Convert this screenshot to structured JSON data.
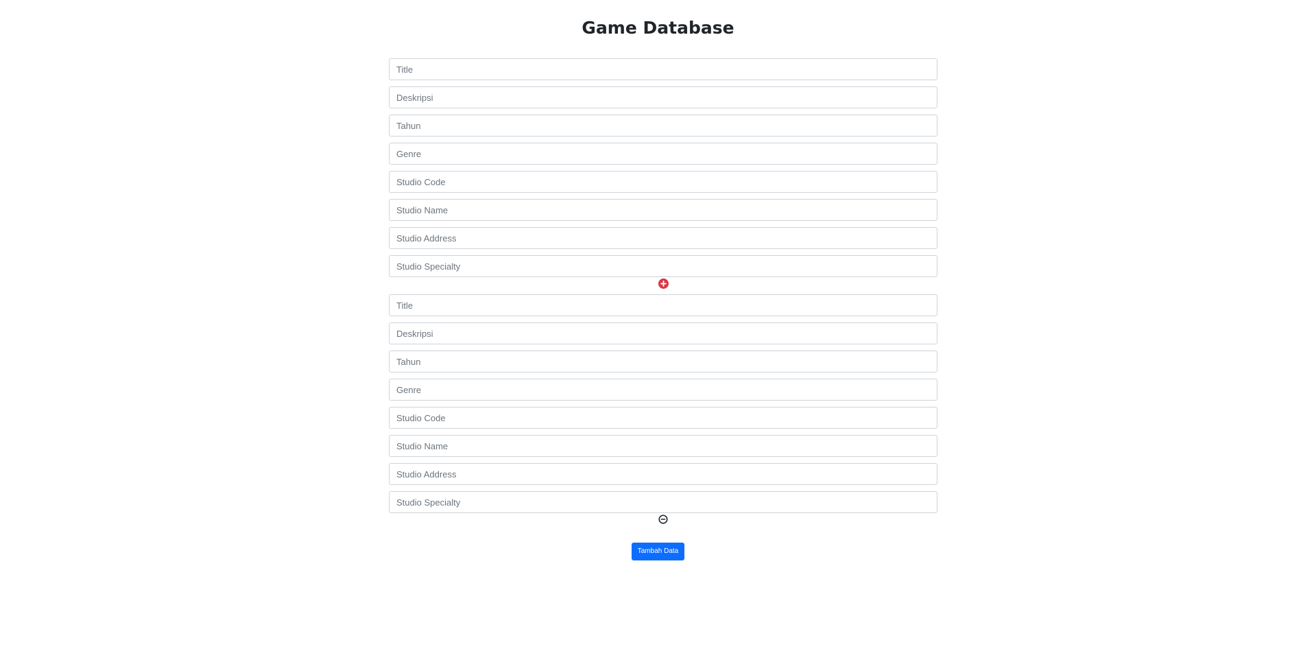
{
  "page": {
    "title": "Game Database"
  },
  "form": {
    "groups": [
      {
        "fields": [
          {
            "placeholder": "Title",
            "value": ""
          },
          {
            "placeholder": "Deskripsi",
            "value": ""
          },
          {
            "placeholder": "Tahun",
            "value": ""
          },
          {
            "placeholder": "Genre",
            "value": ""
          },
          {
            "placeholder": "Studio Code",
            "value": ""
          },
          {
            "placeholder": "Studio Name",
            "value": ""
          },
          {
            "placeholder": "Studio Address",
            "value": ""
          },
          {
            "placeholder": "Studio Specialty",
            "value": ""
          }
        ],
        "action_icon": "plus-circle-icon",
        "action_color": "#dc3545"
      },
      {
        "fields": [
          {
            "placeholder": "Title",
            "value": ""
          },
          {
            "placeholder": "Deskripsi",
            "value": ""
          },
          {
            "placeholder": "Tahun",
            "value": ""
          },
          {
            "placeholder": "Genre",
            "value": ""
          },
          {
            "placeholder": "Studio Code",
            "value": ""
          },
          {
            "placeholder": "Studio Name",
            "value": ""
          },
          {
            "placeholder": "Studio Address",
            "value": ""
          },
          {
            "placeholder": "Studio Specialty",
            "value": ""
          }
        ],
        "action_icon": "minus-circle-icon",
        "action_color": "#212529"
      }
    ],
    "submit_label": "Tambah Data"
  },
  "colors": {
    "primary": "#0d6efd",
    "add_icon": "#dc3545",
    "remove_icon": "#212529",
    "input_border": "#ced4da",
    "placeholder": "#6c757d"
  }
}
